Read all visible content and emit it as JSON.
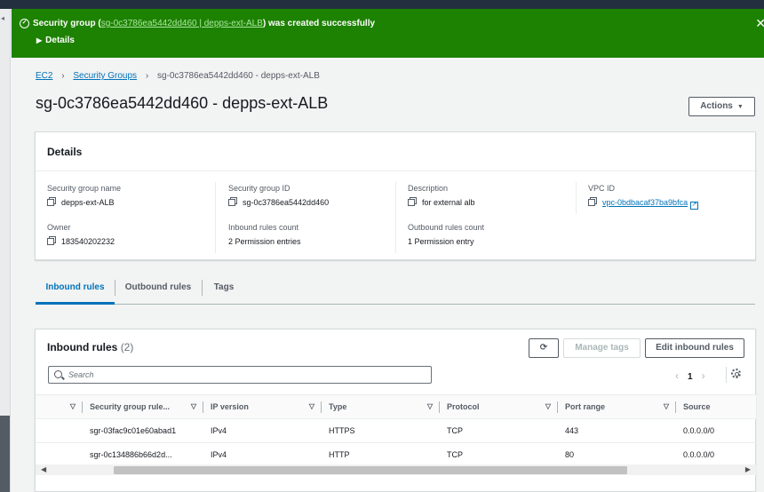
{
  "flash": {
    "prefix": "Security group (",
    "link": "sg-0c3786ea5442dd460 | depps-ext-ALB",
    "suffix": ") was created successfully",
    "details_label": "Details",
    "color": "#1d8102"
  },
  "breadcrumb": {
    "items": [
      "EC2",
      "Security Groups"
    ],
    "current": "sg-0c3786ea5442dd460 - depps-ext-ALB"
  },
  "page_title": "sg-0c3786ea5442dd460 - depps-ext-ALB",
  "actions_label": "Actions",
  "details": {
    "title": "Details",
    "fields": {
      "sg_name": {
        "label": "Security group name",
        "value": "depps-ext-ALB"
      },
      "sg_id": {
        "label": "Security group ID",
        "value": "sg-0c3786ea5442dd460"
      },
      "description": {
        "label": "Description",
        "value": "for external alb"
      },
      "vpc_id": {
        "label": "VPC ID",
        "value": "vpc-0bdbacaf37ba9bfca"
      },
      "owner": {
        "label": "Owner",
        "value": "183540202232"
      },
      "inbound_count": {
        "label": "Inbound rules count",
        "value": "2 Permission entries"
      },
      "outbound_count": {
        "label": "Outbound rules count",
        "value": "1 Permission entry"
      }
    }
  },
  "tabs": [
    "Inbound rules",
    "Outbound rules",
    "Tags"
  ],
  "inbound": {
    "title": "Inbound rules",
    "count": "(2)",
    "manage_tags": "Manage tags",
    "edit": "Edit inbound rules",
    "search_placeholder": "Search",
    "page": "1",
    "columns": [
      "Security group rule...",
      "IP version",
      "Type",
      "Protocol",
      "Port range",
      "Source"
    ],
    "rows": [
      [
        "sgr-03fac9c01e60abad1",
        "IPv4",
        "HTTPS",
        "TCP",
        "443",
        "0.0.0.0/0"
      ],
      [
        "sgr-0c134886b66d2d...",
        "IPv4",
        "HTTP",
        "TCP",
        "80",
        "0.0.0.0/0"
      ]
    ]
  },
  "icons": [
    "success-check-icon",
    "close-icon",
    "caret-right-icon",
    "chevron-right-icon",
    "copy-icon",
    "external-link-icon",
    "refresh-icon",
    "search-icon",
    "settings-gear-icon",
    "sort-caret-icon"
  ],
  "colors": {
    "link": "#0073bb",
    "accent": "#0073bb",
    "text": "#16191f",
    "muted": "#545b64"
  }
}
